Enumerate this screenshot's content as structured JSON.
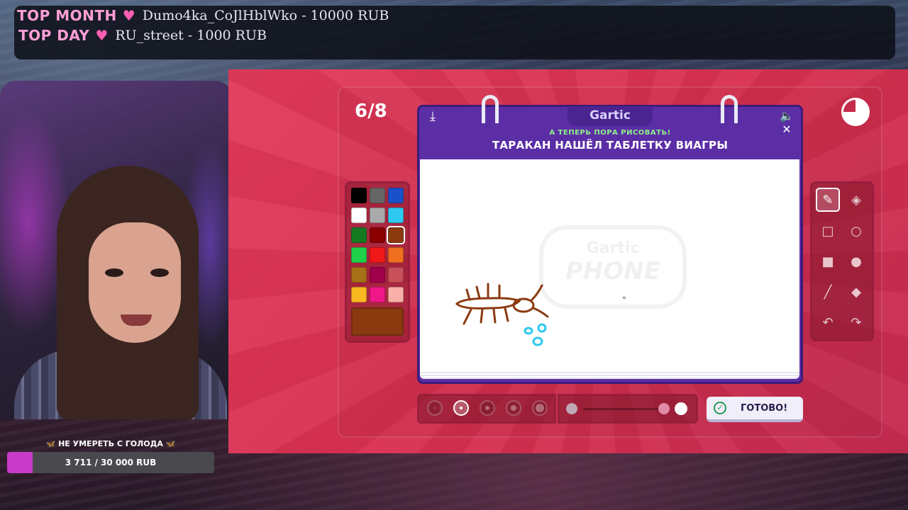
{
  "donations": {
    "top_month_label": "TOP MONTH",
    "top_month_text": "Dumo4ka_CoJlHblWko - 10000 RUB",
    "top_day_label": "TOP DAY",
    "top_day_text": "RU_street - 1000 RUB"
  },
  "goal": {
    "title": "🦋 НЕ УМЕРЕТЬ С ГОЛОДА 🦋",
    "progress_text": "3 711 / 30 000 RUB",
    "progress_fraction": 0.124
  },
  "game": {
    "round": "6/8",
    "logo": "Gartic",
    "instruction_small": "А ТЕПЕРЬ ПОРА РИСОВАТЬ!",
    "instruction_big": "ТАРАКАН НАШЁЛ ТАБЛЕТКУ ВИАГРЫ",
    "watermark_top": "Gartic",
    "watermark_bottom": "PHONE",
    "done_label": "ГОТОВО!",
    "palette": [
      "#000000",
      "#666666",
      "#1a50c8",
      "#ffffff",
      "#aaaaaa",
      "#2ec8f0",
      "#157a22",
      "#8a0000",
      "#8b3a10",
      "#1ed04a",
      "#f01818",
      "#f07020",
      "#a87018",
      "#a0004a",
      "#c8505a",
      "#f8b820",
      "#f01888",
      "#f8b0a8"
    ],
    "selected_color": "#8b3a10",
    "tools": [
      "pencil-icon",
      "eraser-icon",
      "square-outline-icon",
      "circle-outline-icon",
      "square-filled-icon",
      "circle-filled-icon",
      "line-icon",
      "fill-bucket-icon",
      "undo-icon",
      "redo-icon"
    ],
    "selected_tool": "pencil-icon",
    "selected_brush_size": 2
  }
}
